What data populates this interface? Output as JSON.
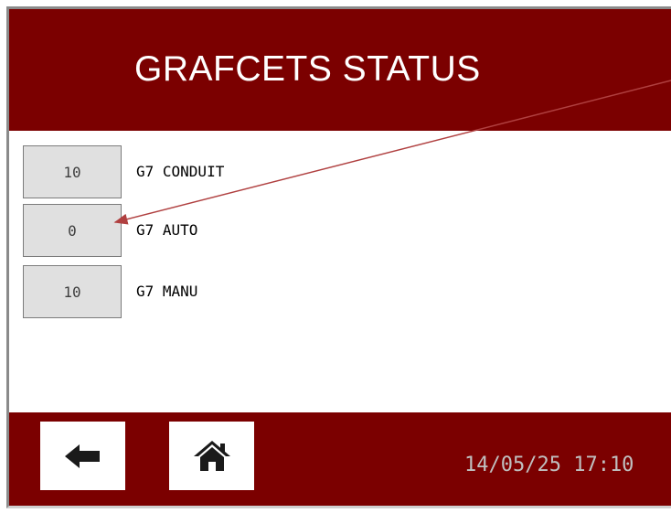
{
  "header": {
    "title": "GRAFCETS STATUS"
  },
  "rows": [
    {
      "value": "10",
      "label": "G7 CONDUIT"
    },
    {
      "value": "0",
      "label": "G7 AUTO"
    },
    {
      "value": "10",
      "label": "G7 MANU"
    }
  ],
  "footer": {
    "back_icon": "arrow-left-icon",
    "home_icon": "home-icon",
    "datetime": "14/05/25 17:10"
  },
  "colors": {
    "header_bg": "#7b0000",
    "box_bg": "#e0e0e0",
    "annotation_arrow": "#b04040"
  }
}
